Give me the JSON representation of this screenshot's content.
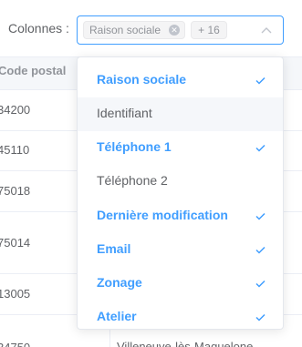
{
  "columns_label": "Colonnes :",
  "select": {
    "tags": [
      {
        "label": "Raison sociale",
        "closable": true
      },
      {
        "label": "+ 16",
        "closable": false
      }
    ],
    "chevron_icon": "chevron-up-icon"
  },
  "table": {
    "header": {
      "postal_code": "Code postal"
    },
    "rows": [
      {
        "postal_code": "34200",
        "city": ""
      },
      {
        "postal_code": "45110",
        "city": ""
      },
      {
        "postal_code": "75018",
        "city": ""
      },
      {
        "postal_code": "75014",
        "city": ""
      },
      {
        "postal_code": "13005",
        "city": ""
      },
      {
        "postal_code": "34750",
        "city": "Villeneuve-lès-Maguelone"
      }
    ]
  },
  "dropdown": {
    "options": [
      {
        "label": "Raison sociale",
        "selected": true,
        "hover": false
      },
      {
        "label": "Identifiant",
        "selected": false,
        "hover": true
      },
      {
        "label": "Téléphone 1",
        "selected": true,
        "hover": false
      },
      {
        "label": "Téléphone 2",
        "selected": false,
        "hover": false
      },
      {
        "label": "Dernière modification",
        "selected": true,
        "hover": false
      },
      {
        "label": "Email",
        "selected": true,
        "hover": false
      },
      {
        "label": "Zonage",
        "selected": true,
        "hover": false
      },
      {
        "label": "Atelier",
        "selected": true,
        "hover": false
      }
    ],
    "check_icon": "check-icon"
  },
  "colors": {
    "accent": "#409eff",
    "text": "#606266",
    "muted": "#909399",
    "hover_bg": "#f5f7fa",
    "tag_bg": "#f4f4f5",
    "border": "#e4e7ed"
  }
}
